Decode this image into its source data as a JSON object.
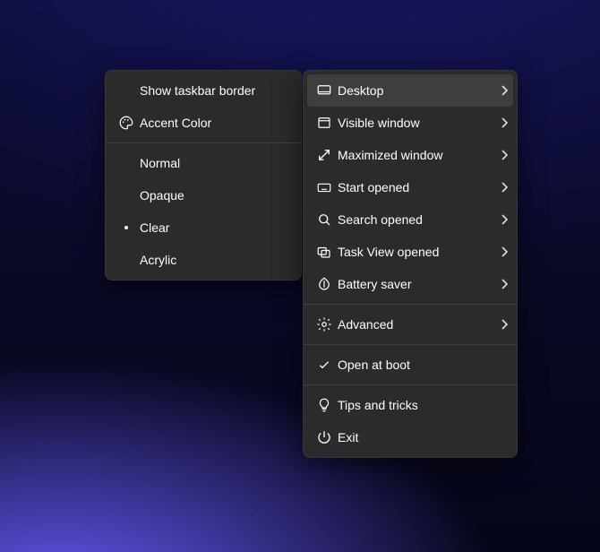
{
  "left_menu": {
    "items": [
      {
        "label": "Show taskbar border",
        "icon": ""
      },
      {
        "label": "Accent Color",
        "icon": "palette"
      },
      {
        "label": "Normal",
        "icon": ""
      },
      {
        "label": "Opaque",
        "icon": ""
      },
      {
        "label": "Clear",
        "icon": "bullet"
      },
      {
        "label": "Acrylic",
        "icon": ""
      }
    ]
  },
  "right_menu": {
    "items": [
      {
        "label": "Desktop",
        "icon": "desktop",
        "submenu": true,
        "highlight": true
      },
      {
        "label": "Visible window",
        "icon": "window",
        "submenu": true
      },
      {
        "label": "Maximized window",
        "icon": "maximize",
        "submenu": true
      },
      {
        "label": "Start opened",
        "icon": "keyboard",
        "submenu": true
      },
      {
        "label": "Search opened",
        "icon": "search",
        "submenu": true
      },
      {
        "label": "Task View opened",
        "icon": "taskview",
        "submenu": true
      },
      {
        "label": "Battery saver",
        "icon": "leaf",
        "submenu": true
      },
      {
        "label": "Advanced",
        "icon": "gear",
        "submenu": true
      },
      {
        "label": "Open at boot",
        "icon": "check"
      },
      {
        "label": "Tips and tricks",
        "icon": "bulb"
      },
      {
        "label": "Exit",
        "icon": "power"
      }
    ]
  }
}
